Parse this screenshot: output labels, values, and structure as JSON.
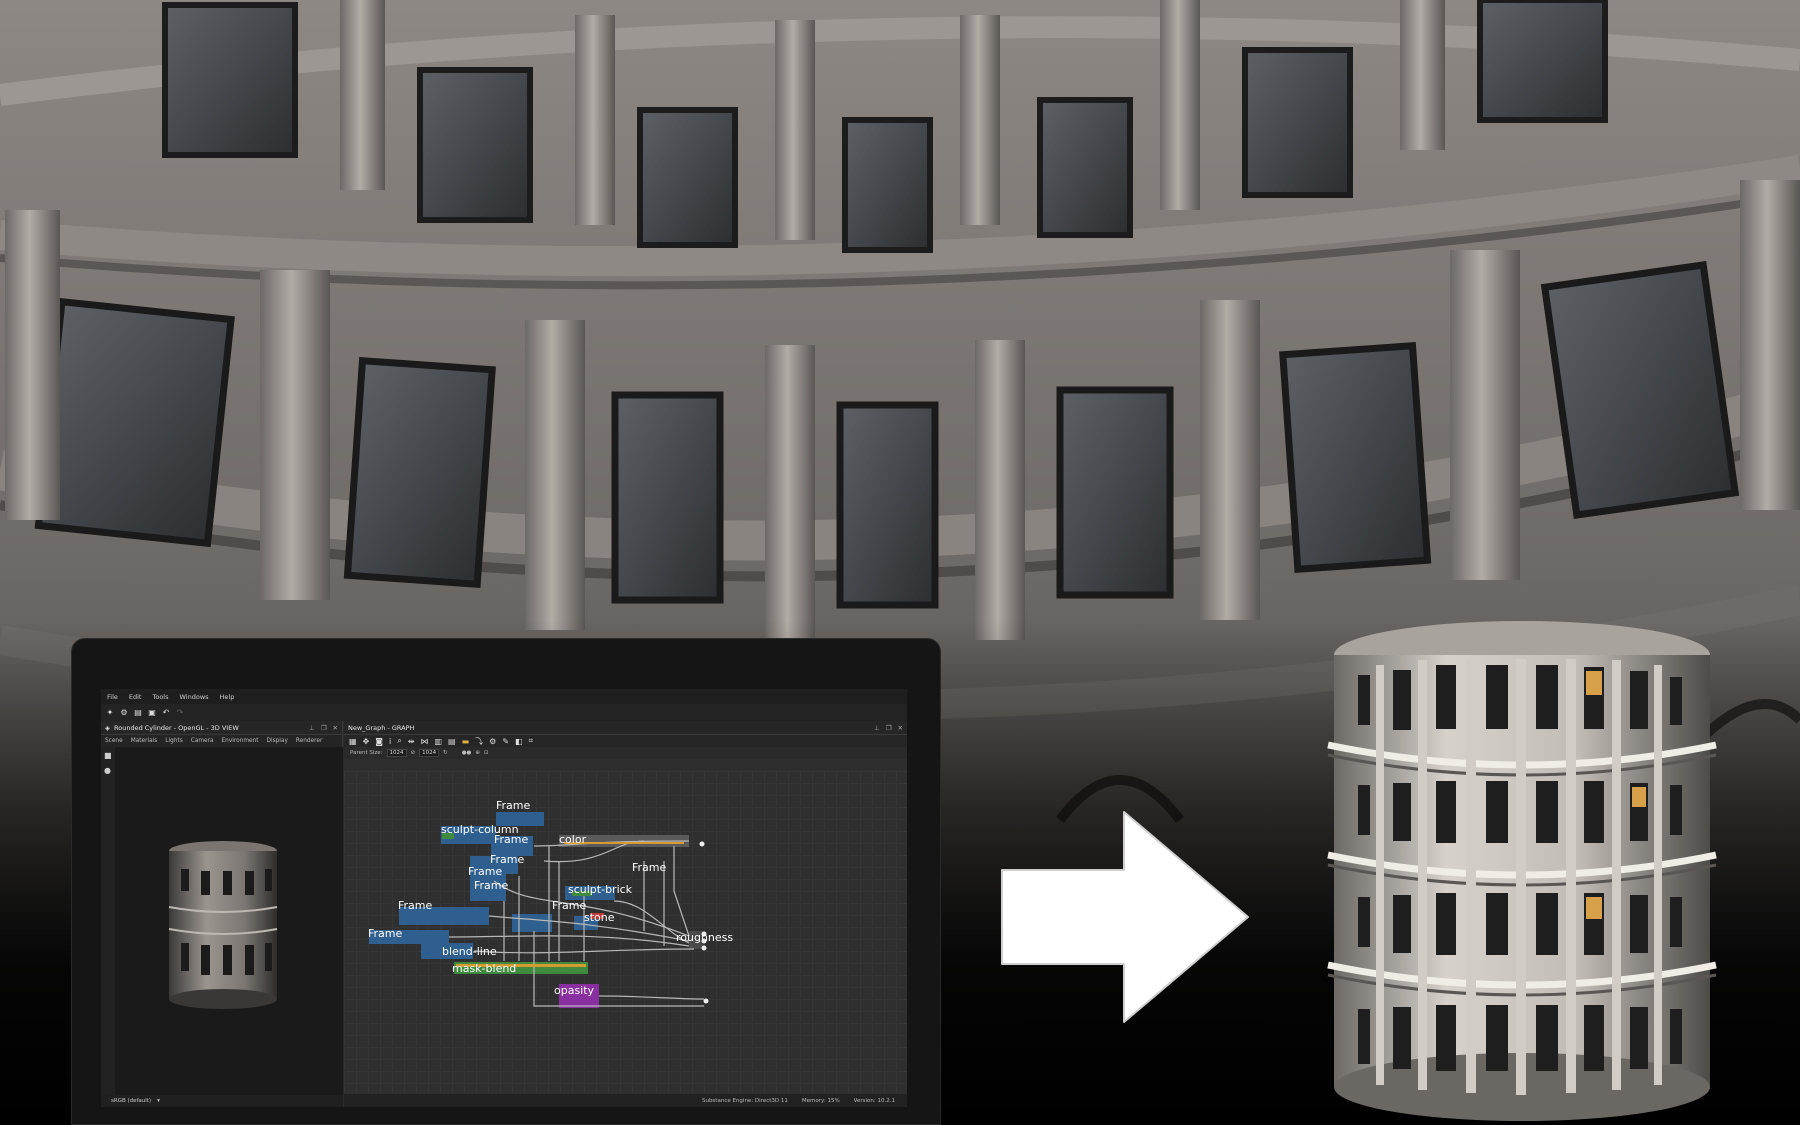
{
  "menu": [
    "File",
    "Edit",
    "Tools",
    "Windows",
    "Help"
  ],
  "view3d": {
    "title": "Rounded Cylinder - OpenGL - 3D VIEW",
    "tabs": [
      "Scene",
      "Materials",
      "Lights",
      "Camera",
      "Environment",
      "Display",
      "Renderer"
    ],
    "colorspace": "sRGB (default)"
  },
  "graph": {
    "title": "New_Graph - GRAPH",
    "parent_size_label": "Parent Size:",
    "size_w": "1024",
    "size_h": "1024",
    "frames": [
      "Frame",
      "sculpt-column",
      "Frame",
      "color",
      "Frame",
      "Frame",
      "Frame",
      "sculpt-brick",
      "Frame",
      "Frame",
      "Frame",
      "stone",
      "roughness",
      "Frame",
      "blend-line",
      "mask-blend",
      "opasity"
    ]
  },
  "status": {
    "engine": "Substance Engine: Direct3D 11",
    "memory": "Memory: 15%",
    "version": "Version: 10.2.1"
  },
  "colors": {
    "accent_node_blue": "#2f5f8f",
    "node_green": "#3f8a3f",
    "node_purple": "#8a2fa0",
    "node_orange": "#d79a30"
  }
}
